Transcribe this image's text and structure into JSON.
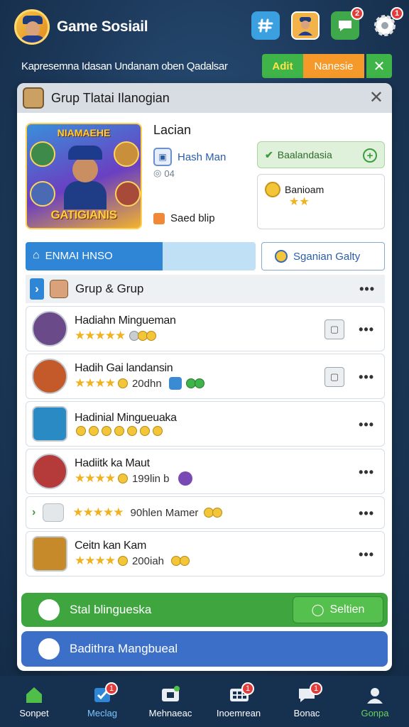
{
  "header": {
    "title": "Game Sosiail",
    "icons": [
      {
        "name": "hashtag-icon",
        "badge": ""
      },
      {
        "name": "avatar-icon",
        "badge": ""
      },
      {
        "name": "chat-icon",
        "badge": "2"
      },
      {
        "name": "gear-icon",
        "badge": "1"
      }
    ]
  },
  "subbar": {
    "text": "Kapresemna Idasan Undanam oben Qadalsar",
    "pill_green": "Adit",
    "pill_orange": "Nanesie",
    "close": "✕"
  },
  "panel": {
    "title": "Grup Tlatai Ilanogian",
    "close": "✕",
    "featured": {
      "top_text": "NIAMAEHE",
      "bottom_text": "GATIGIANIS"
    },
    "info": {
      "title": "Lacian",
      "link": "Hash Man",
      "sub": "04",
      "bottom": "Saed blip"
    },
    "green_card": "Baalandasia",
    "white_card": {
      "title": "Banioam",
      "stars": "★★"
    },
    "tab_primary": "ENMAI HNSO",
    "tab_secondary": "Sganian Galty",
    "group_head": "Grup & Grup",
    "items": [
      {
        "title": "Hadiahn Mingueman",
        "meta": "",
        "thumb": "#6b4a8a"
      },
      {
        "title": "Hadih Gai landansin",
        "meta": "20dhn",
        "thumb": "#c45a2a"
      },
      {
        "title": "Hadinial Mingueuaka",
        "meta": "",
        "thumb": "#2a8ac4"
      },
      {
        "title": "Hadiitk ka Maut",
        "meta": "199lin b",
        "thumb": "#b53a3a"
      },
      {
        "title": "",
        "meta": "90hlen Mamer",
        "thumb": ""
      },
      {
        "title": "Ceitn kan Kam",
        "meta": "200iah",
        "thumb": "#c68a2a"
      }
    ],
    "cta_green": {
      "label": "Stal blingueska",
      "button": "Seltien"
    },
    "cta_blue": "Badithra Mangbueal"
  },
  "nav": [
    {
      "label": "Sonpet",
      "badge": ""
    },
    {
      "label": "Meclag",
      "badge": "1"
    },
    {
      "label": "Mehnaeac",
      "badge": ""
    },
    {
      "label": "Inoemrean",
      "badge": "1"
    },
    {
      "label": "Bonac",
      "badge": "1"
    },
    {
      "label": "Gonpa",
      "badge": ""
    }
  ],
  "colors": {
    "accent_blue": "#2f86d6",
    "accent_green": "#3fa63f",
    "accent_orange": "#f59a2a",
    "badge_red": "#e23b3b"
  }
}
